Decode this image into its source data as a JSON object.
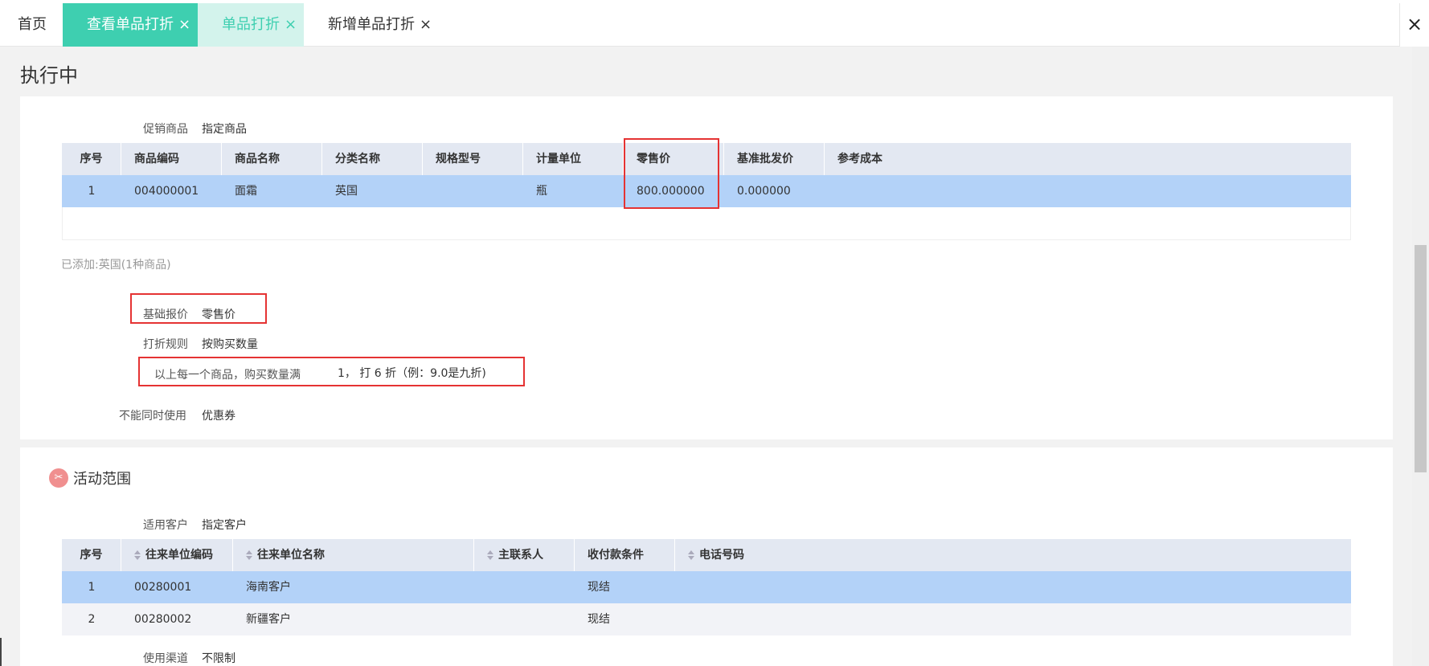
{
  "tabs": {
    "home": "首页",
    "view": "查看单品打折",
    "single": "单品打折",
    "new": "新增单品打折",
    "close": "×"
  },
  "page_title": "执行中",
  "promo": {
    "label": "促销商品",
    "value": "指定商品",
    "columns": [
      "序号",
      "商品编码",
      "商品名称",
      "分类名称",
      "规格型号",
      "计量单位",
      "零售价",
      "基准批发价",
      "参考成本"
    ],
    "rows": [
      [
        "1",
        "004000001",
        "面霜",
        "英国",
        "",
        "瓶",
        "800.000000",
        "0.000000",
        ""
      ]
    ],
    "added_note": "已添加:英国(1种商品)"
  },
  "base_price": {
    "label": "基础报价",
    "value": "零售价"
  },
  "discount_rule": {
    "label": "打折规则",
    "value": "按购买数量"
  },
  "rule_text": {
    "prefix": "以上每一个商品，购买数量满",
    "detail": "1， 打 6 折（例：9.0是九折)"
  },
  "exclusive": {
    "label": "不能同时使用",
    "value": "优惠券"
  },
  "scope": {
    "icon": "scope-icon",
    "title": "活动范围",
    "customer_label": "适用客户",
    "customer_value": "指定客户",
    "columns": [
      "序号",
      "往来单位编码",
      "往来单位名称",
      "主联系人",
      "收付款条件",
      "电话号码"
    ],
    "rows": [
      [
        "1",
        "00280001",
        "海南客户",
        "",
        "现结",
        ""
      ],
      [
        "2",
        "00280002",
        "新疆客户",
        "",
        "现结",
        ""
      ]
    ],
    "channel_label": "使用渠道",
    "channel_value": "不限制"
  }
}
